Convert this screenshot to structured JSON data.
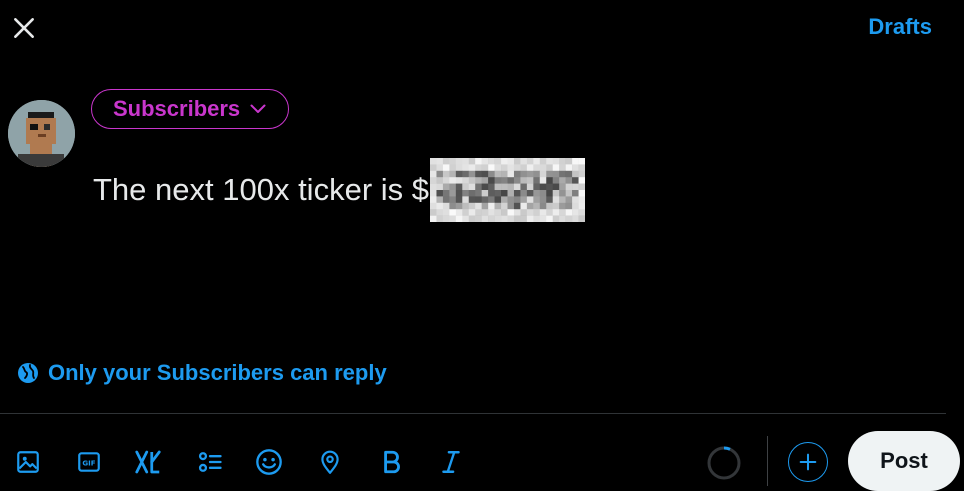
{
  "header": {
    "close_icon": "close-icon",
    "drafts_label": "Drafts"
  },
  "audience": {
    "label": "Subscribers",
    "icon": "chevron-down-icon",
    "color": "#c936cc"
  },
  "composer": {
    "text": "The next 100x ticker is $"
  },
  "reply_setting": {
    "icon": "globe-icon",
    "label": "Only your Subscribers can reply"
  },
  "toolbar": {
    "tools": [
      "image-icon",
      "gif-icon",
      "grok-icon",
      "poll-icon",
      "emoji-icon",
      "location-icon",
      "bold-icon",
      "italic-icon"
    ],
    "post_label": "Post"
  },
  "colors": {
    "accent": "#1d9bf0",
    "background": "#000000",
    "text": "#e7e9ea"
  }
}
